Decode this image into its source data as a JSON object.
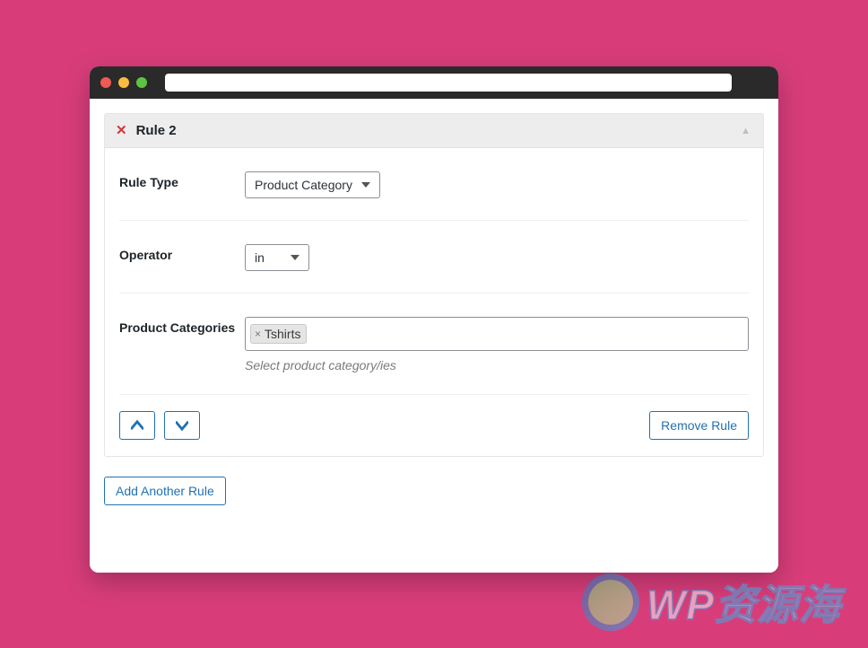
{
  "rule": {
    "title": "Rule 2",
    "fields": {
      "rule_type": {
        "label": "Rule Type",
        "value": "Product Category"
      },
      "operator": {
        "label": "Operator",
        "value": "in"
      },
      "product_categories": {
        "label": "Product Categories",
        "hint": "Select product category/ies",
        "tags": [
          "Tshirts"
        ]
      }
    },
    "actions": {
      "remove": "Remove Rule"
    }
  },
  "add_button": "Add Another Rule",
  "watermark": "WP资源海"
}
